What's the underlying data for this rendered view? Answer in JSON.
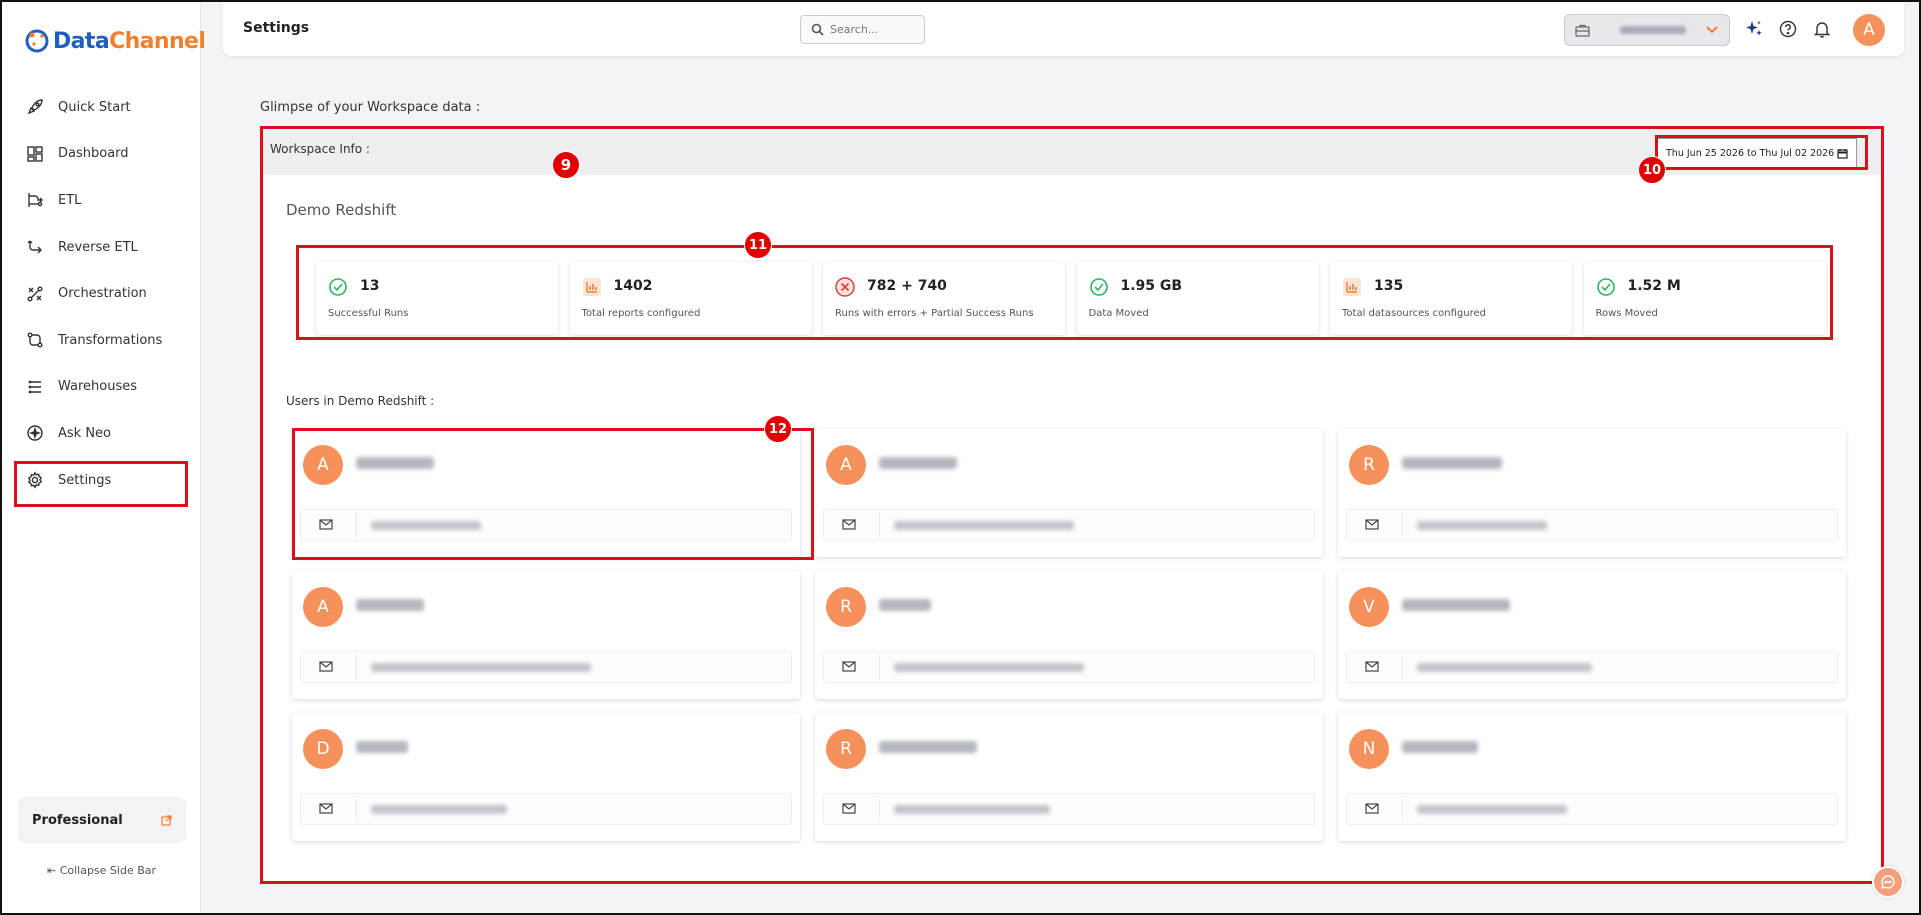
{
  "app": {
    "logo_prefix": "Data",
    "logo_suffix": "Channel"
  },
  "sidebar": {
    "items": [
      {
        "label": "Quick Start",
        "icon": "rocket-icon"
      },
      {
        "label": "Dashboard",
        "icon": "dashboard-icon"
      },
      {
        "label": "ETL",
        "icon": "etl-icon"
      },
      {
        "label": "Reverse ETL",
        "icon": "reverse-etl-icon"
      },
      {
        "label": "Orchestration",
        "icon": "orchestration-icon"
      },
      {
        "label": "Transformations",
        "icon": "transformations-icon"
      },
      {
        "label": "Warehouses",
        "icon": "warehouses-icon"
      },
      {
        "label": "Ask Neo",
        "icon": "ask-neo-icon"
      },
      {
        "label": "Settings",
        "icon": "gear-icon"
      }
    ],
    "active": "Settings",
    "plan_label": "Professional",
    "collapse_label": "Collapse Side Bar"
  },
  "header": {
    "title": "Settings",
    "search_placeholder": "Search...",
    "avatar_letter": "A"
  },
  "main": {
    "glimpse_title": "Glimpse of your Workspace data :",
    "workspace_info_label": "Workspace Info :",
    "date_range": "Thu Jun 25 2026 to Thu Jul 02 2026",
    "workspace_name": "Demo Redshift",
    "stats": [
      {
        "value": "13",
        "caption": "Successful Runs",
        "icon": "check-circle-icon"
      },
      {
        "value": "1402",
        "caption": "Total reports configured",
        "icon": "report-icon"
      },
      {
        "value": "782 + 740",
        "caption": "Runs with errors + Partial Success Runs",
        "icon": "error-circle-icon"
      },
      {
        "value": "1.95 GB",
        "caption": "Data Moved",
        "icon": "check-circle-icon"
      },
      {
        "value": "135",
        "caption": "Total datasources configured",
        "icon": "report-icon"
      },
      {
        "value": "1.52 M",
        "caption": "Rows Moved",
        "icon": "check-circle-icon"
      }
    ],
    "users_label": "Users in Demo Redshift :",
    "users": [
      {
        "initial": "A"
      },
      {
        "initial": "A"
      },
      {
        "initial": "R"
      },
      {
        "initial": "A"
      },
      {
        "initial": "R"
      },
      {
        "initial": "V"
      },
      {
        "initial": "D"
      },
      {
        "initial": "R"
      },
      {
        "initial": "N"
      }
    ]
  },
  "annotations": {
    "b9": "9",
    "b10": "10",
    "b11": "11",
    "b12": "12"
  },
  "colors": {
    "accent_orange": "#f7915c",
    "highlight_red": "#d8111b",
    "success_green": "#2fb35a",
    "error_red": "#e53935"
  }
}
